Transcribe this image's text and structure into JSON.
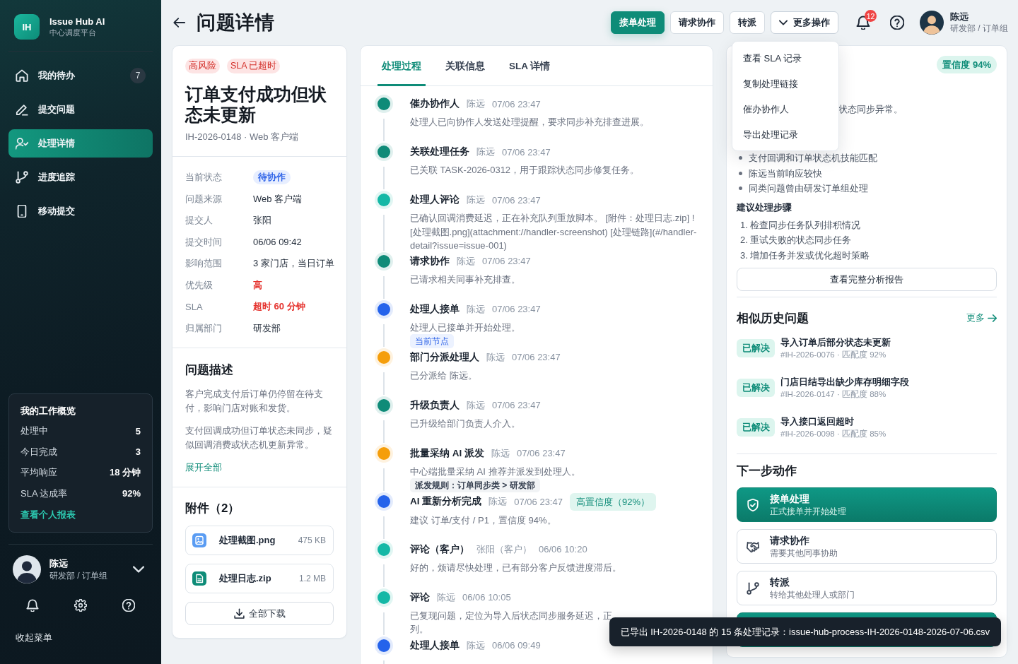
{
  "sidebar": {
    "logo": {
      "mark": "IH",
      "name": "Issue Hub AI",
      "subtitle": "中心调度平台"
    },
    "nav": [
      {
        "label": "我的待办",
        "badge": "7",
        "selected": false
      },
      {
        "label": "提交问题",
        "selected": false
      },
      {
        "label": "处理详情",
        "selected": true
      },
      {
        "label": "进度追踪",
        "selected": false
      },
      {
        "label": "移动提交",
        "selected": false
      }
    ],
    "overview": {
      "title": "我的工作概览",
      "rows": [
        {
          "label": "处理中",
          "value": "5"
        },
        {
          "label": "今日完成",
          "value": "3"
        },
        {
          "label": "平均响应",
          "value": "18 分钟"
        },
        {
          "label": "SLA 达成率",
          "value": "92%"
        }
      ],
      "link": "查看个人报表"
    },
    "user": {
      "name": "陈远",
      "department": "研发部 / 订单组"
    },
    "collapse": "收起菜单"
  },
  "header": {
    "title": "问题详情",
    "actions": [
      {
        "label": "接单处理",
        "kind": "primary"
      },
      {
        "label": "请求协作",
        "kind": "default"
      },
      {
        "label": "转派",
        "kind": "default"
      },
      {
        "label": "更多操作",
        "kind": "dropdown",
        "expanded": true,
        "menu": [
          "查看 SLA 记录",
          "复制处理链接",
          "催办协作人",
          "导出处理记录"
        ]
      }
    ],
    "notification_count": "12",
    "user": {
      "name": "陈远",
      "department": "研发部 / 订单组"
    }
  },
  "issue": {
    "tags": [
      "高风险",
      "SLA 已超时"
    ],
    "title": "订单支付成功但状态未更新",
    "meta": "IH-2026-0148 · Web 客户端",
    "fields": [
      {
        "label": "当前状态",
        "value": "待协作",
        "kind": "status"
      },
      {
        "label": "问题来源",
        "value": "Web 客户端",
        "kind": "text"
      },
      {
        "label": "提交人",
        "value": "张阳",
        "kind": "text"
      },
      {
        "label": "提交时间",
        "value": "06/06 09:42",
        "kind": "text"
      },
      {
        "label": "影响范围",
        "value": "3 家门店，当日订单",
        "kind": "text"
      },
      {
        "label": "优先级",
        "value": "高",
        "kind": "alert"
      },
      {
        "label": "SLA",
        "value": "超时 60 分钟",
        "kind": "alert"
      },
      {
        "label": "归属部门",
        "value": "研发部",
        "kind": "text"
      }
    ],
    "description": {
      "title": "问题描述",
      "paragraphs": [
        "客户完成支付后订单仍停留在待支付，影响门店对账和发货。",
        "支付回调成功但订单状态未同步，疑似回调消费或状态机更新异常。"
      ],
      "expand": "展开全部"
    },
    "attachments": {
      "title": "附件（2）",
      "files": [
        {
          "name": "处理截图.png",
          "size": "475 KB",
          "kind": "image"
        },
        {
          "name": "处理日志.zip",
          "size": "1.2 MB",
          "kind": "document"
        }
      ],
      "download_all": "全部下载"
    }
  },
  "timeline": {
    "tabs": [
      {
        "label": "处理过程",
        "selected": true
      },
      {
        "label": "关联信息",
        "selected": false
      },
      {
        "label": "SLA 详情",
        "selected": false
      }
    ],
    "events": [
      {
        "title": "催办协作人",
        "actor": "陈远",
        "time": "07/06 23:47",
        "color": "#0f8b78",
        "body": "处理人已向协作人发送处理提醒，要求同步补充排查进展。"
      },
      {
        "title": "关联处理任务",
        "actor": "陈远",
        "time": "07/06 23:47",
        "color": "#0f8b78",
        "body": "已关联 TASK-2026-0312，用于跟踪状态同步修复任务。"
      },
      {
        "title": "处理人评论",
        "actor": "陈远",
        "time": "07/06 23:47",
        "color": "#14b8a6",
        "body": "已确认回调消费延迟，正在补充队列重放脚本。 [附件：处理日志.zip] ![处理截图.png](attachment://handler-screenshot) [处理链路](#/handler-detail?issue=issue-001)"
      },
      {
        "title": "请求协作",
        "actor": "陈远",
        "time": "07/06 23:47",
        "color": "#0f8b78",
        "body": "已请求相关同事补充排查。"
      },
      {
        "title": "处理人接单",
        "actor": "陈远",
        "time": "07/06 23:47",
        "color": "#2563eb",
        "body": "处理人已接单并开始处理。",
        "tag": {
          "kind": "current",
          "text": "当前节点"
        }
      },
      {
        "title": "部门分派处理人",
        "actor": "陈远",
        "time": "07/06 23:47",
        "color": "#f59e0b",
        "body": "已分派给 陈远。"
      },
      {
        "title": "升级负责人",
        "actor": "陈远",
        "time": "07/06 23:47",
        "color": "#0f8b78",
        "body": "已升级给部门负责人介入。"
      },
      {
        "title": "批量采纳 AI 派发",
        "actor": "陈远",
        "time": "07/06 23:47",
        "color": "#f59e0b",
        "body": "中心端批量采纳 AI 推荐并派发到处理人。",
        "tag": {
          "kind": "rule",
          "text": "派发规则：订单同步类 > 研发部"
        }
      },
      {
        "title": "AI 重新分析完成",
        "actor": "陈远",
        "time": "07/06 23:47",
        "color": "#2563eb",
        "badge": "高置信度（92%）",
        "body": "建议 订单/支付 / P1，置信度 94%。"
      },
      {
        "title": "评论（客户）",
        "actor": "张阳（客户）",
        "time": "06/06 10:20",
        "color": "#14b8a6",
        "body": "好的，烦请尽快处理，已有部分客户反馈进度滞后。"
      },
      {
        "title": "评论",
        "actor": "陈远",
        "time": "06/06 10:05",
        "color": "#14b8a6",
        "body": "已复现问题，定位为导入后状态同步服务延迟，正",
        "body_cont": "列。"
      },
      {
        "title": "处理人接单",
        "actor": "陈远",
        "time": "06/06 09:49",
        "color": "#2563eb"
      }
    ]
  },
  "analysis": {
    "confidence": "置信度 94%",
    "summary": "状态同步异常。",
    "bullets": [
      "支付回调和订单状态机技能匹配",
      "陈远当前响应较快",
      "同类问题曾由研发订单组处理"
    ],
    "steps": {
      "title": "建议处理步骤",
      "items": [
        "1. 检查同步任务队列排积情况",
        "2. 重试失败的状态同步任务",
        "3. 增加任务并发或优化超时策略"
      ]
    },
    "report_button": "查看完整分析报告",
    "similar": {
      "title": "相似历史问题",
      "more": "更多",
      "items": [
        {
          "status": "已解决",
          "title": "导入订单后部分状态未更新",
          "meta": "#IH-2026-0076 · 匹配度 92%"
        },
        {
          "status": "已解决",
          "title": "门店日结导出缺少库存明细字段",
          "meta": "#IH-2026-0147 · 匹配度 88%"
        },
        {
          "status": "已解决",
          "title": "导入接口返回超时",
          "meta": "#IH-2026-0098 · 匹配度 85%"
        }
      ]
    },
    "next_actions": {
      "title": "下一步动作",
      "items": [
        {
          "kind": "primary",
          "title": "接单处理",
          "subtitle": "正式接单并开始处理"
        },
        {
          "kind": "default",
          "title": "请求协作",
          "subtitle": "需要其他同事协助"
        },
        {
          "kind": "default",
          "title": "转派",
          "subtitle": "转给其他处理人或部门"
        },
        {
          "kind": "primary"
        }
      ]
    }
  },
  "toast": "已导出 IH-2026-0148 的 15 条处理记录：issue-hub-process-IH-2026-0148-2026-07-06.csv"
}
